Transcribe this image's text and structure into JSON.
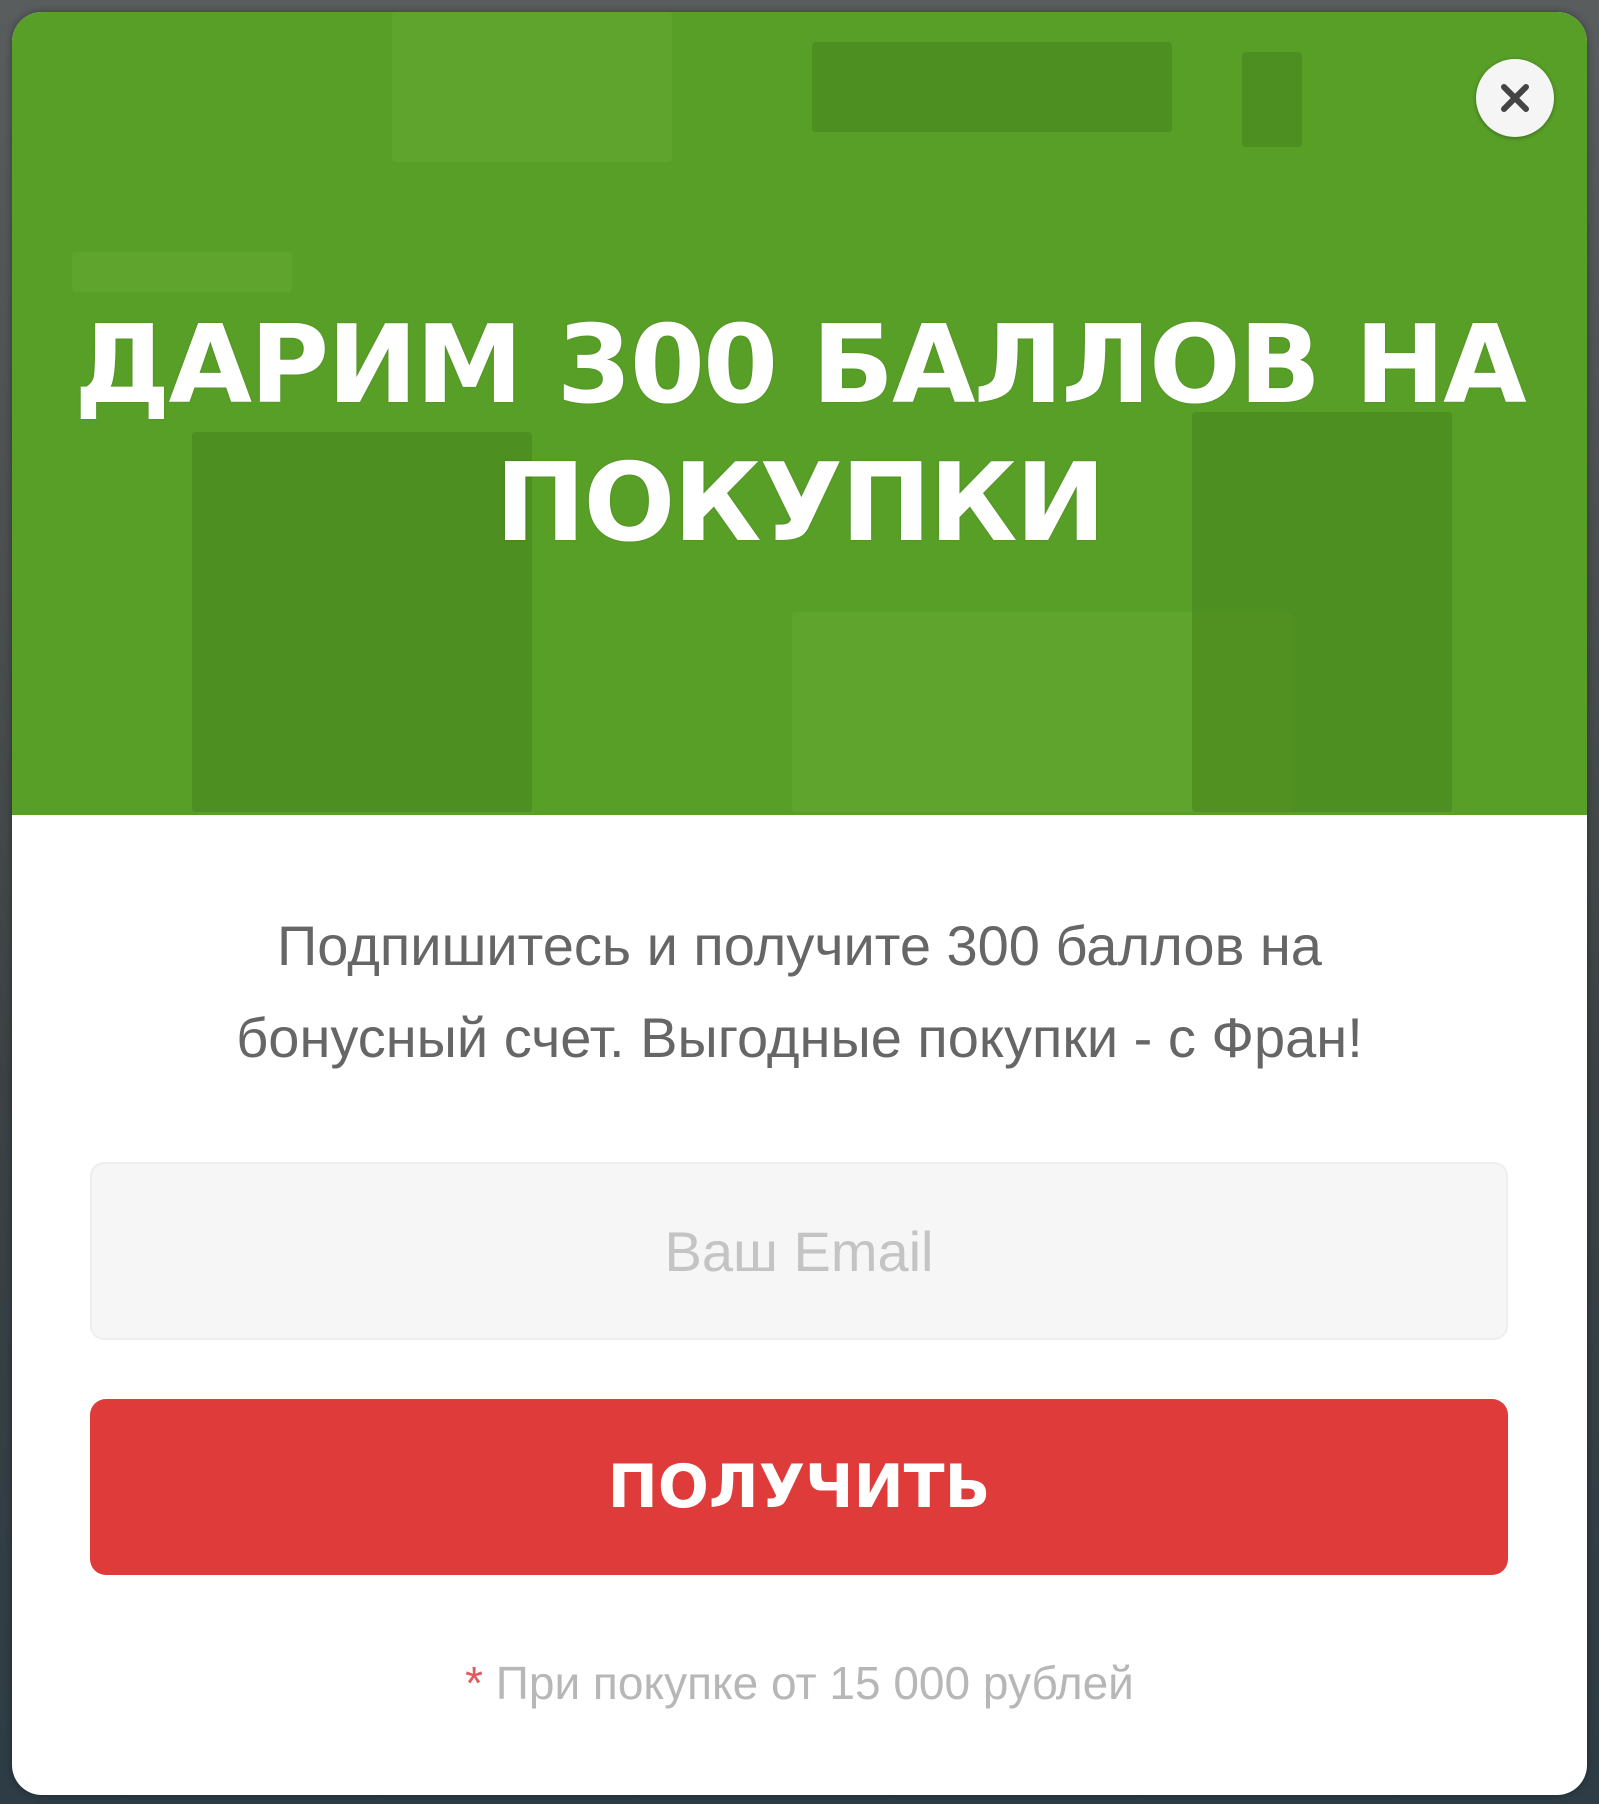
{
  "popup": {
    "headline_line1": "ДАРИМ 300 БАЛЛОВ НА",
    "headline_line2": "ПОКУПКИ",
    "close_icon": "close-icon",
    "description_line1": "Подпишитесь и получите 300 баллов на",
    "description_line2": "бонусный счет. Выгодные покупки - с Фран!",
    "email": {
      "value": "",
      "placeholder": "Ваш Email"
    },
    "submit_label": "ПОЛУЧИТЬ",
    "footnote_asterisk": "*",
    "footnote_text": " При покупке от 15 000 рублей"
  },
  "colors": {
    "banner_green": "#589f28",
    "button_red": "#df3b3b",
    "text_gray": "#666666",
    "footnote_gray": "#b7b7b7",
    "asterisk_red": "#e35a5a"
  }
}
